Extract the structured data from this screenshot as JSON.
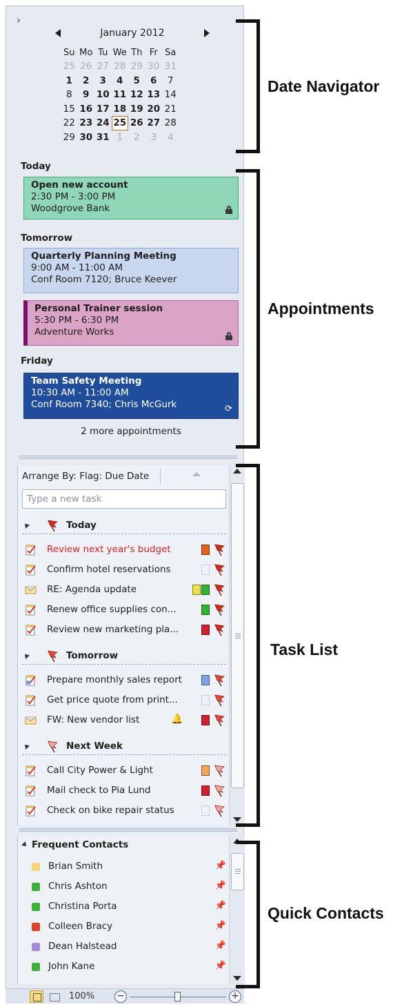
{
  "date_navigator": {
    "expand_glyph": "›",
    "month_title": "January 2012",
    "weekday_headers": [
      "Su",
      "Mo",
      "Tu",
      "We",
      "Th",
      "Fr",
      "Sa"
    ],
    "weeks": [
      [
        {
          "d": "25",
          "m": "other"
        },
        {
          "d": "26",
          "m": "other"
        },
        {
          "d": "27",
          "m": "other"
        },
        {
          "d": "28",
          "m": "other"
        },
        {
          "d": "29",
          "m": "other"
        },
        {
          "d": "30",
          "m": "other"
        },
        {
          "d": "31",
          "m": "other"
        }
      ],
      [
        {
          "d": "1",
          "b": true
        },
        {
          "d": "2",
          "b": true
        },
        {
          "d": "3",
          "b": true
        },
        {
          "d": "4",
          "b": true
        },
        {
          "d": "5",
          "b": true
        },
        {
          "d": "6",
          "b": true
        },
        {
          "d": "7"
        }
      ],
      [
        {
          "d": "8"
        },
        {
          "d": "9",
          "b": true
        },
        {
          "d": "10",
          "b": true
        },
        {
          "d": "11",
          "b": true
        },
        {
          "d": "12",
          "b": true
        },
        {
          "d": "13",
          "b": true
        },
        {
          "d": "14"
        }
      ],
      [
        {
          "d": "15"
        },
        {
          "d": "16",
          "b": true
        },
        {
          "d": "17",
          "b": true
        },
        {
          "d": "18",
          "b": true
        },
        {
          "d": "19",
          "b": true
        },
        {
          "d": "20",
          "b": true
        },
        {
          "d": "21"
        }
      ],
      [
        {
          "d": "22"
        },
        {
          "d": "23",
          "b": true
        },
        {
          "d": "24",
          "b": true
        },
        {
          "d": "25",
          "b": true,
          "today": true
        },
        {
          "d": "26",
          "b": true
        },
        {
          "d": "27",
          "b": true
        },
        {
          "d": "28"
        }
      ],
      [
        {
          "d": "29"
        },
        {
          "d": "30",
          "b": true
        },
        {
          "d": "31",
          "b": true
        },
        {
          "d": "1",
          "m": "other"
        },
        {
          "d": "2",
          "m": "other"
        },
        {
          "d": "3",
          "m": "other"
        },
        {
          "d": "4",
          "m": "other"
        }
      ]
    ]
  },
  "appointments": {
    "today_label": "Today",
    "tomorrow_label": "Tomorrow",
    "friday_label": "Friday",
    "items": [
      {
        "title": "Open new account",
        "time": "2:30 PM - 3:00 PM",
        "location": "Woodgrove Bank"
      },
      {
        "title": "Quarterly Planning Meeting",
        "time": "9:00 AM - 11:00 AM",
        "location": "Conf Room 7120; Bruce Keever"
      },
      {
        "title": "Personal Trainer session",
        "time": "5:30 PM - 6:30 PM",
        "location": "Adventure Works"
      },
      {
        "title": "Team Safety Meeting",
        "time": "10:30 AM - 11:00 AM",
        "location": "Conf Room 7340; Chris McGurk"
      }
    ],
    "more_link": "2 more appointments"
  },
  "task_list": {
    "arrange_by": "Arrange By: Flag: Due Date",
    "new_task_placeholder": "Type a new task",
    "groups": [
      {
        "name": "Today",
        "tasks": [
          {
            "title": "Review next year's budget",
            "overdue": true,
            "categories": [
              "#e0611a"
            ],
            "icon": "task"
          },
          {
            "title": "Confirm hotel reservations",
            "categories": [
              "none"
            ],
            "icon": "task"
          },
          {
            "title": "RE: Agenda update",
            "categories": [
              "#f0e24a",
              "#34b233"
            ],
            "icon": "mail"
          },
          {
            "title": "Renew office supplies con...",
            "categories": [
              "#34b233"
            ],
            "icon": "task"
          },
          {
            "title": "Review new marketing pla...",
            "categories": [
              "#cf2030"
            ],
            "icon": "task"
          }
        ]
      },
      {
        "name": "Tomorrow",
        "tasks": [
          {
            "title": "Prepare monthly sales report",
            "categories": [
              "#7fa3e0"
            ],
            "icon": "recurring-task"
          },
          {
            "title": "Get price quote from print...",
            "categories": [
              "none"
            ],
            "icon": "task"
          },
          {
            "title": "FW: New vendor list",
            "categories": [
              "#cf2030"
            ],
            "icon": "mail",
            "reminder": true
          }
        ]
      },
      {
        "name": "Next Week",
        "tasks": [
          {
            "title": "Call City Power & Light",
            "categories": [
              "#f0a65a"
            ],
            "icon": "task"
          },
          {
            "title": "Mail check to Pia Lund",
            "categories": [
              "#cf2030"
            ],
            "icon": "task"
          },
          {
            "title": "Check on bike repair status",
            "categories": [
              "none"
            ],
            "icon": "task"
          }
        ]
      }
    ]
  },
  "contacts": {
    "header": "Frequent Contacts",
    "items": [
      {
        "name": "Brian Smith",
        "status_color": "#f6d67a"
      },
      {
        "name": "Chris Ashton",
        "status_color": "#3cb23c"
      },
      {
        "name": "Christina Porta",
        "status_color": "#3cb23c"
      },
      {
        "name": "Colleen Bracy",
        "status_color": "#d9452c"
      },
      {
        "name": "Dean Halstead",
        "status_color": "#a38bd6"
      },
      {
        "name": "John Kane",
        "status_color": "#3cb23c"
      }
    ]
  },
  "status_bar": {
    "zoom": "100%",
    "zoom_out": "−",
    "zoom_in": "+",
    "zoom_level_fraction": 0.5
  },
  "labels": {
    "date_navigator": "Date Navigator",
    "appointments": "Appointments",
    "task_list": "Task List",
    "quick_contacts": "Quick Contacts"
  },
  "colors": {
    "appt_green": "#8fd7b7",
    "appt_blue": "#c9d7ee",
    "appt_pink": "#dba3c5",
    "appt_navy": "#1f4d9c",
    "today_outline": "#d2691e",
    "overdue_text": "#d62222"
  }
}
